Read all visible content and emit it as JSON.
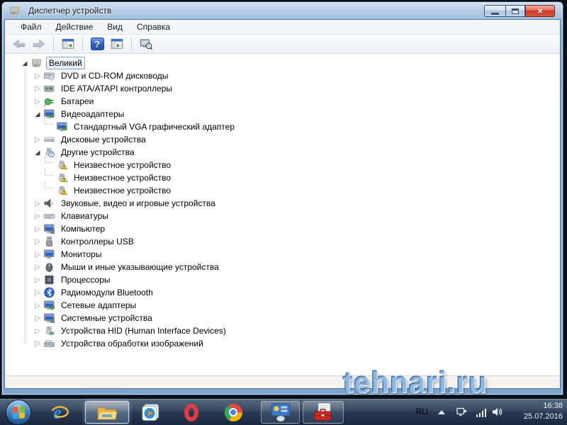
{
  "window": {
    "title": "Диспетчер устройств",
    "icon": "device-manager-icon",
    "controls": [
      "minimize",
      "maximize",
      "close"
    ]
  },
  "menu": {
    "items": [
      {
        "label": "Файл"
      },
      {
        "label": "Действие"
      },
      {
        "label": "Вид"
      },
      {
        "label": "Справка"
      }
    ]
  },
  "toolbar": {
    "buttons": [
      "back-icon",
      "forward-icon",
      "console-tree-icon",
      "help-icon",
      "action-pane-icon",
      "scan-hardware-icon"
    ]
  },
  "tree": {
    "items": [
      {
        "label": "Великий",
        "icon": "computer-icon",
        "level": 0,
        "expander": "expanded",
        "selected": true
      },
      {
        "label": "DVD и CD-ROM дисководы",
        "icon": "dvd-drive-icon",
        "level": 1,
        "expander": "collapsed"
      },
      {
        "label": "IDE ATA/ATAPI контроллеры",
        "icon": "ide-controller-icon",
        "level": 1,
        "expander": "collapsed"
      },
      {
        "label": "Батареи",
        "icon": "battery-icon",
        "level": 1,
        "expander": "collapsed"
      },
      {
        "label": "Видеоадаптеры",
        "icon": "display-adapter-icon",
        "level": 1,
        "expander": "expanded"
      },
      {
        "label": "Стандартный VGA графический адаптер",
        "icon": "display-adapter-icon",
        "level": 2,
        "expander": "none"
      },
      {
        "label": "Дисковые устройства",
        "icon": "disk-drive-icon",
        "level": 1,
        "expander": "collapsed"
      },
      {
        "label": "Другие устройства",
        "icon": "unknown-category-icon",
        "level": 1,
        "expander": "expanded"
      },
      {
        "label": "Неизвестное устройство",
        "icon": "warning-device-icon",
        "level": 2,
        "expander": "none"
      },
      {
        "label": "Неизвестное устройство",
        "icon": "warning-device-icon",
        "level": 2,
        "expander": "none"
      },
      {
        "label": "Неизвестное устройство",
        "icon": "warning-device-icon",
        "level": 2,
        "expander": "none"
      },
      {
        "label": "Звуковые, видео и игровые устройства",
        "icon": "speaker-icon",
        "level": 1,
        "expander": "collapsed"
      },
      {
        "label": "Клавиатуры",
        "icon": "keyboard-icon",
        "level": 1,
        "expander": "collapsed"
      },
      {
        "label": "Компьютер",
        "icon": "computer-node-icon",
        "level": 1,
        "expander": "collapsed"
      },
      {
        "label": "Контроллеры USB",
        "icon": "usb-icon",
        "level": 1,
        "expander": "collapsed"
      },
      {
        "label": "Мониторы",
        "icon": "monitor-icon",
        "level": 1,
        "expander": "collapsed"
      },
      {
        "label": "Мыши и иные указывающие устройства",
        "icon": "mouse-icon",
        "level": 1,
        "expander": "collapsed"
      },
      {
        "label": "Процессоры",
        "icon": "cpu-icon",
        "level": 1,
        "expander": "collapsed"
      },
      {
        "label": "Радиомодули Bluetooth",
        "icon": "bluetooth-icon",
        "level": 1,
        "expander": "collapsed"
      },
      {
        "label": "Сетевые адаптеры",
        "icon": "network-adapter-icon",
        "level": 1,
        "expander": "collapsed"
      },
      {
        "label": "Системные устройства",
        "icon": "system-device-icon",
        "level": 1,
        "expander": "collapsed"
      },
      {
        "label": "Устройства HID (Human Interface Devices)",
        "icon": "hid-device-icon",
        "level": 1,
        "expander": "collapsed"
      },
      {
        "label": "Устройства обработки изображений",
        "icon": "imaging-device-icon",
        "level": 1,
        "expander": "collapsed"
      }
    ]
  },
  "watermark": {
    "text": "tehnari.ru"
  },
  "taskbar": {
    "apps": [
      {
        "name": "start-button"
      },
      {
        "name": "internet-explorer"
      },
      {
        "name": "windows-explorer",
        "active": true
      },
      {
        "name": "windows-media-player"
      },
      {
        "name": "opera"
      },
      {
        "name": "chrome"
      },
      {
        "name": "hardware-panel",
        "open": true
      },
      {
        "name": "admin-toolbox",
        "open": true
      }
    ],
    "tray": {
      "language": "RU",
      "time": "16:38",
      "date": "25.07.2016"
    }
  },
  "colors": {
    "titlebar_blue": "#8db0d5",
    "close_red": "#cc3a23",
    "taskbar_dark": "#273750",
    "selection_border": "#84a3cc",
    "warning_yellow": "#f6d53c"
  }
}
